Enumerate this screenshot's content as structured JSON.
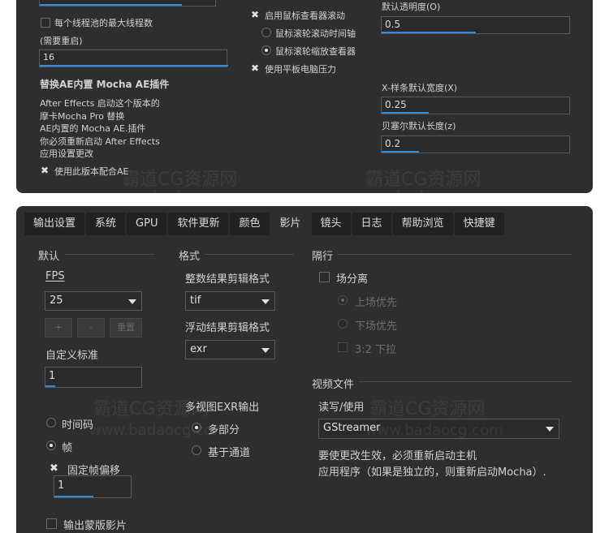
{
  "top_panel": {
    "max_threads_label": "每个线程池的最大线程数",
    "restart_note": "(需要重启)",
    "threads_value": "16",
    "plugin_heading": "替换AE内置 Mocha AE插件",
    "plugin_desc": [
      "After Effects 启动这个版本的",
      "摩卡Mocha Pro 替换",
      "AE内置的 Mocha AE.插件",
      "你必须重新启动 After Effects",
      "应用设置更改"
    ],
    "use_version_label": "使用此版本配合AE",
    "mouse_scroll_label": "启用鼠标查看器滚动",
    "wheel_time_label": "鼠标滚轮滚动时间轴",
    "wheel_zoom_label": "鼠标滚轮缩放查看器",
    "tablet_label": "使用平板电脑压力",
    "opacity_label": "默认透明度(O)",
    "opacity_value": "0.5",
    "opacity_level": 0.5,
    "xspline_label": "X-样条默认宽度(X)",
    "xspline_value": "0.25",
    "xspline_level": 0.25,
    "bezier_label": "贝塞尔默认长度(z)",
    "bezier_value": "0.2",
    "bezier_level": 0.2
  },
  "tabs": [
    "输出设置",
    "系统",
    "GPU",
    "软件更新",
    "颜色",
    "影片",
    "镜头",
    "日志",
    "帮助浏览",
    "快捷键"
  ],
  "active_tab": "影片",
  "defaults": {
    "heading": "默认",
    "fps_label": "FPS",
    "fps_value": "25",
    "plus_label": "+",
    "minus_label": "-",
    "reset_label": "重置",
    "custom_std_label": "自定义标准",
    "custom_std_value": "1",
    "timecode_label": "时间码",
    "frame_label": "帧",
    "fixed_offset_label": "固定帧偏移",
    "fixed_offset_value": "1",
    "output_matte_label": "输出蒙版影片"
  },
  "format": {
    "heading": "格式",
    "int_clip_label": "整数结果剪辑格式",
    "int_clip_value": "tif",
    "float_clip_label": "浮动结果剪辑格式",
    "float_clip_value": "exr",
    "multiview_label": "多视图EXR输出",
    "multipart_label": "多部分",
    "by_channel_label": "基于通道"
  },
  "interlace": {
    "heading": "隔行",
    "field_sep_label": "场分离",
    "upper_first_label": "上场优先",
    "lower_first_label": "下场优先",
    "pulldown_label": "3:2 下拉"
  },
  "video_file": {
    "heading": "视频文件",
    "rw_label": "读写/使用",
    "engine_value": "GStreamer",
    "note_line1": "要使更改生效，必须重新启动主机",
    "note_line2": "应用程序（如果是独立的，则重新启动Mocha）."
  },
  "watermark": {
    "text1": "霸道CG资源网",
    "text2": "www.badaocg.com"
  }
}
